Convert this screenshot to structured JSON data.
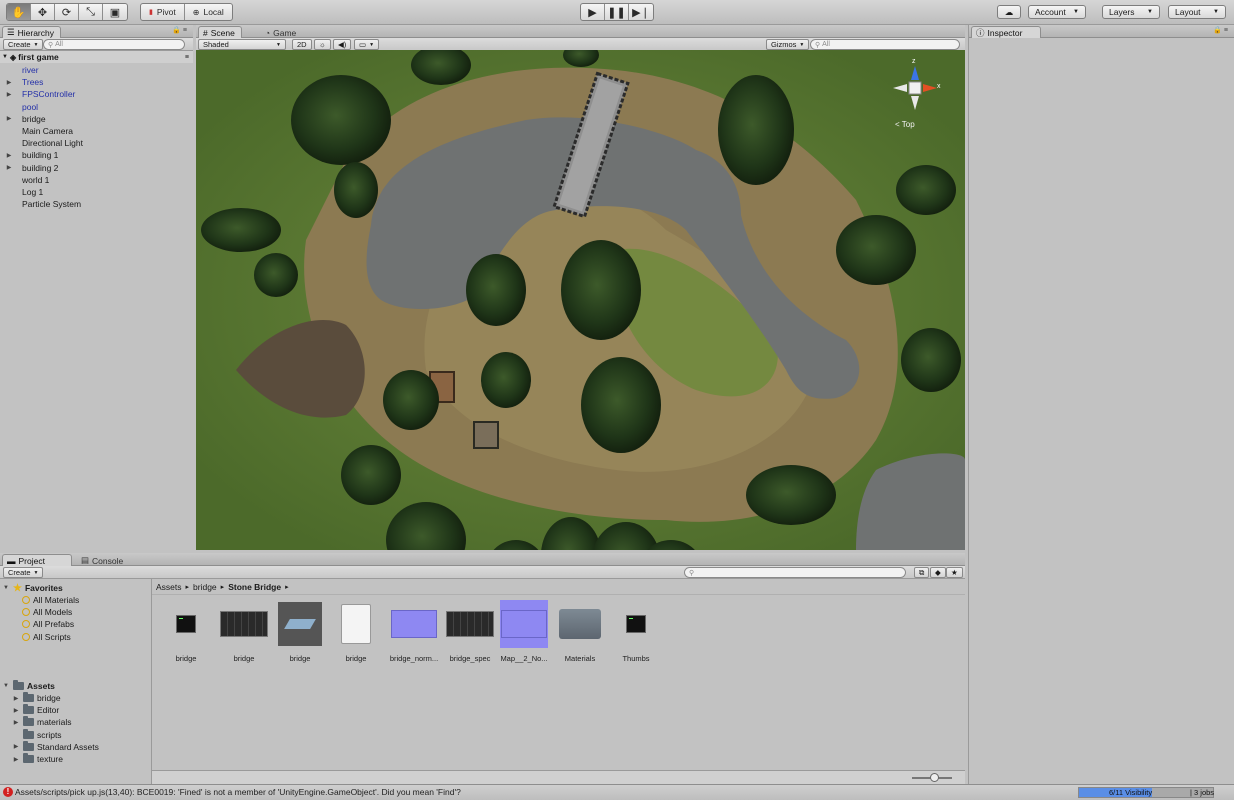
{
  "toolbar": {
    "tools": [
      "hand-tool",
      "move-tool",
      "rotate-tool",
      "scale-tool",
      "rect-tool"
    ],
    "pivot_label": "Pivot",
    "local_label": "Local",
    "account_label": "Account",
    "layers_label": "Layers",
    "layout_label": "Layout"
  },
  "hierarchy": {
    "tab_label": "Hierarchy",
    "create_label": "Create",
    "search_placeholder": "All",
    "scene_name": "first game",
    "items": [
      {
        "label": "river",
        "prefab": true,
        "expandable": false
      },
      {
        "label": "Trees",
        "prefab": true,
        "expandable": true
      },
      {
        "label": "FPSController",
        "prefab": true,
        "expandable": true
      },
      {
        "label": "pool",
        "prefab": true,
        "expandable": false
      },
      {
        "label": "bridge",
        "prefab": false,
        "expandable": true
      },
      {
        "label": "Main Camera",
        "prefab": false,
        "expandable": false
      },
      {
        "label": "Directional Light",
        "prefab": false,
        "expandable": false
      },
      {
        "label": "building 1",
        "prefab": false,
        "expandable": true
      },
      {
        "label": "building 2",
        "prefab": false,
        "expandable": true
      },
      {
        "label": "world 1",
        "prefab": false,
        "expandable": false
      },
      {
        "label": "Log 1",
        "prefab": false,
        "expandable": false
      },
      {
        "label": "Particle System",
        "prefab": false,
        "expandable": false
      }
    ]
  },
  "scene": {
    "tab_scene": "Scene",
    "tab_game": "Game",
    "shading_mode": "Shaded",
    "mode_2d": "2D",
    "gizmos_label": "Gizmos",
    "search_placeholder": "All",
    "gizmo_view_label": "< Top",
    "axis_x": "x",
    "axis_z": "z"
  },
  "inspector": {
    "tab_label": "Inspector"
  },
  "project": {
    "tab_project": "Project",
    "tab_console": "Console",
    "create_label": "Create",
    "favorites_label": "Favorites",
    "favorites": [
      "All Materials",
      "All Models",
      "All Prefabs",
      "All Scripts"
    ],
    "assets_label": "Assets",
    "asset_folders": [
      {
        "label": "bridge",
        "expandable": true
      },
      {
        "label": "Editor",
        "expandable": true
      },
      {
        "label": "materials",
        "expandable": true
      },
      {
        "label": "scripts",
        "expandable": false
      },
      {
        "label": "Standard Assets",
        "expandable": true
      },
      {
        "label": "texture",
        "expandable": true
      }
    ],
    "breadcrumb": [
      "Assets",
      "bridge",
      "Stone Bridge"
    ],
    "assets": [
      {
        "label": "bridge",
        "kind": "script"
      },
      {
        "label": "bridge",
        "kind": "texture-dark"
      },
      {
        "label": "bridge",
        "kind": "model"
      },
      {
        "label": "bridge",
        "kind": "material"
      },
      {
        "label": "bridge_norm...",
        "kind": "normal-map"
      },
      {
        "label": "bridge_spec",
        "kind": "texture-dark"
      },
      {
        "label": "Map__2_No...",
        "kind": "normal-map"
      },
      {
        "label": "Materials",
        "kind": "folder"
      },
      {
        "label": "Thumbs",
        "kind": "script"
      }
    ]
  },
  "status": {
    "error_message": "Assets/scripts/pick up.js(13,40): BCE0019: 'Fined' is not a member of 'UnityEngine.GameObject'. Did you mean 'Find'?",
    "progress_label": "6/11 Visibility",
    "progress_fraction": 0.545,
    "jobs_label": "3 jobs"
  },
  "colors": {
    "prefab_text": "#2430a8",
    "progress_fill": "#5a8ee6",
    "error_icon": "#d22020",
    "favorite_star": "#e6b517"
  }
}
